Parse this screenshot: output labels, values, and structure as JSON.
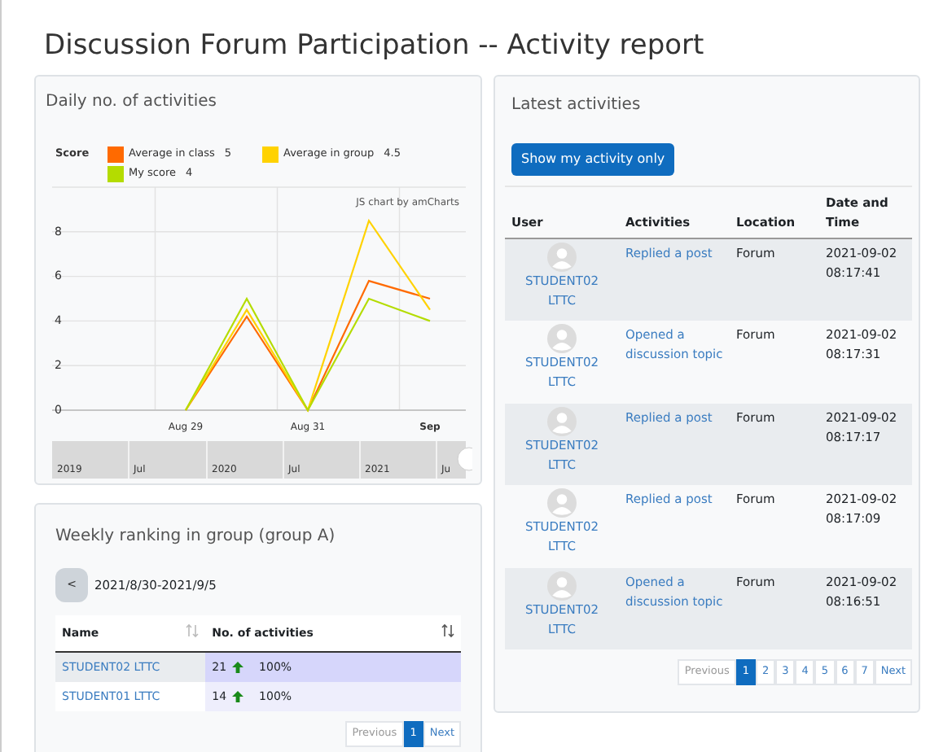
{
  "page_title": "Discussion Forum Participation -- Activity report",
  "daily": {
    "title": "Daily no. of activities",
    "legend_title": "Score",
    "legend_values": [
      "5",
      "4.5",
      "4"
    ],
    "credit": "JS chart by amCharts",
    "chart_data": {
      "type": "line",
      "categories": [
        "Aug 29",
        null,
        "Aug 31",
        null,
        "Sep"
      ],
      "yticks": [
        0,
        2,
        4,
        6,
        8
      ],
      "ylim": [
        0,
        10
      ],
      "grid": true,
      "legend": "top",
      "series": [
        {
          "name": "Average in class",
          "color": "#ff6a00",
          "values": [
            0,
            4.2,
            0,
            5.8,
            5
          ]
        },
        {
          "name": "Average in group",
          "color": "#ffd200",
          "values": [
            0,
            4.5,
            0,
            8.5,
            4.5
          ]
        },
        {
          "name": "My score",
          "color": "#b4dc00",
          "values": [
            0,
            5,
            0,
            5,
            4
          ]
        }
      ]
    },
    "navigator_labels": [
      "2019",
      "Jul",
      "2020",
      "Jul",
      "2021",
      "Ju"
    ]
  },
  "ranking": {
    "title": "Weekly ranking in group (group A)",
    "prev_button": "<",
    "week": "2021/8/30-2021/9/5",
    "columns": [
      "Name",
      "No. of activities"
    ],
    "rows": [
      {
        "name": "STUDENT02 LTTC",
        "count": "21",
        "rising": true,
        "percent": "100%"
      },
      {
        "name": "STUDENT01 LTTC",
        "count": "14",
        "rising": true,
        "percent": "100%"
      }
    ],
    "pagination": {
      "previous": "Previous",
      "pages": [
        {
          "label": "1",
          "selected": true
        }
      ],
      "next": "Next"
    }
  },
  "latest": {
    "title": "Latest activities",
    "button": "Show my activity only",
    "columns": [
      "User",
      "Activities",
      "Location",
      "Date and Time"
    ],
    "rows": [
      {
        "user": "STUDENT02 LTTC",
        "activity": "Replied a post",
        "location": "Forum",
        "datetime": "2021-09-02 08:17:41"
      },
      {
        "user": "STUDENT02 LTTC",
        "activity": "Opened a discussion topic",
        "location": "Forum",
        "datetime": "2021-09-02 08:17:31"
      },
      {
        "user": "STUDENT02 LTTC",
        "activity": "Replied a post",
        "location": "Forum",
        "datetime": "2021-09-02 08:17:17"
      },
      {
        "user": "STUDENT02 LTTC",
        "activity": "Replied a post",
        "location": "Forum",
        "datetime": "2021-09-02 08:17:09"
      },
      {
        "user": "STUDENT02 LTTC",
        "activity": "Opened a discussion topic",
        "location": "Forum",
        "datetime": "2021-09-02 08:16:51"
      }
    ],
    "pagination": {
      "previous": "Previous",
      "pages": [
        {
          "label": "1",
          "selected": true
        },
        {
          "label": "2",
          "selected": false
        },
        {
          "label": "3",
          "selected": false
        },
        {
          "label": "4",
          "selected": false
        },
        {
          "label": "5",
          "selected": false
        },
        {
          "label": "6",
          "selected": false
        },
        {
          "label": "7",
          "selected": false
        }
      ],
      "next": "Next"
    }
  }
}
